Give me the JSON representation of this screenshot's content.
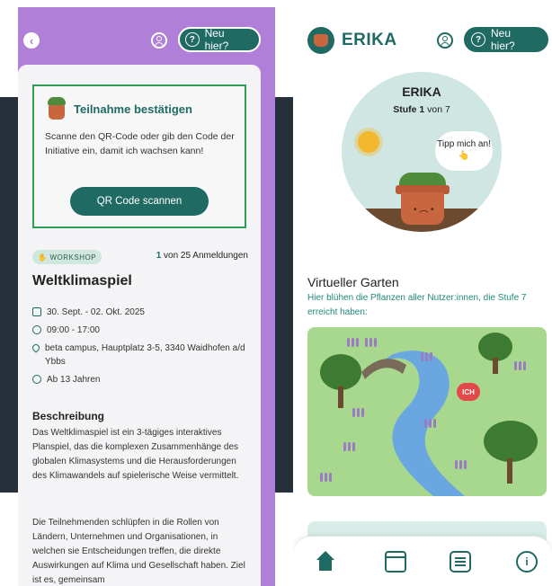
{
  "left_screen": {
    "header": {
      "neu_hier_label": "Neu hier?",
      "help_glyph": "?",
      "back_glyph": "‹"
    },
    "confirm": {
      "title": "Teilnahme bestätigen",
      "text": "Scanne den QR-Code oder gib den Code der Initiative ein, damit ich wachsen kann!",
      "button_label": "QR Code scannen"
    },
    "event": {
      "badge": "WORKSHOP",
      "registrations_count": "1",
      "registrations_suffix": " von 25 Anmeldungen",
      "title": "Weltklimaspiel",
      "date": "30. Sept. - 02. Okt. 2025",
      "time": "09:00 - 17:00",
      "location": "beta campus, Hauptplatz 3-5, 3340 Waidhofen a/d Ybbs",
      "age": "Ab 13 Jahren",
      "description_title": "Beschreibung",
      "description_p1": "Das Weltklimaspiel ist ein 3-tägiges interaktives Planspiel, das die komplexen Zusammenhänge des globalen Klimasystems und die Herausforderungen des Klimawandels auf spielerische Weise vermittelt.",
      "description_p2": "Die Teilnehmenden schlüpfen in die Rollen von Ländern, Unternehmen und Organisationen, in welchen sie Entscheidungen treffen, die direkte Auswirkungen auf Klima und Gesellschaft haben. Ziel ist es, gemeinsam"
    }
  },
  "right_screen": {
    "header": {
      "app_name": "ERIKA",
      "neu_hier_label": "Neu hier?",
      "help_glyph": "?"
    },
    "plant": {
      "name": "ERIKA",
      "level_label": "Stufe 1",
      "level_suffix": " von 7",
      "bubble_text": "Tipp mich an! 👆"
    },
    "garden": {
      "title": "Virtueller Garten",
      "subtitle": "Hier blühen die Pflanzen aller Nutzer:innen, die Stufe 7 erreicht haben:",
      "me_marker": "ICH"
    },
    "nav": {
      "items": [
        "home",
        "calendar",
        "list",
        "info"
      ],
      "info_glyph": "i"
    }
  },
  "colors": {
    "accent_teal": "#1f6b63",
    "purple_bg": "#b07fd8",
    "confirm_border": "#2e9e56",
    "garden_green": "#a8d88e",
    "me_marker_red": "#e54848"
  }
}
